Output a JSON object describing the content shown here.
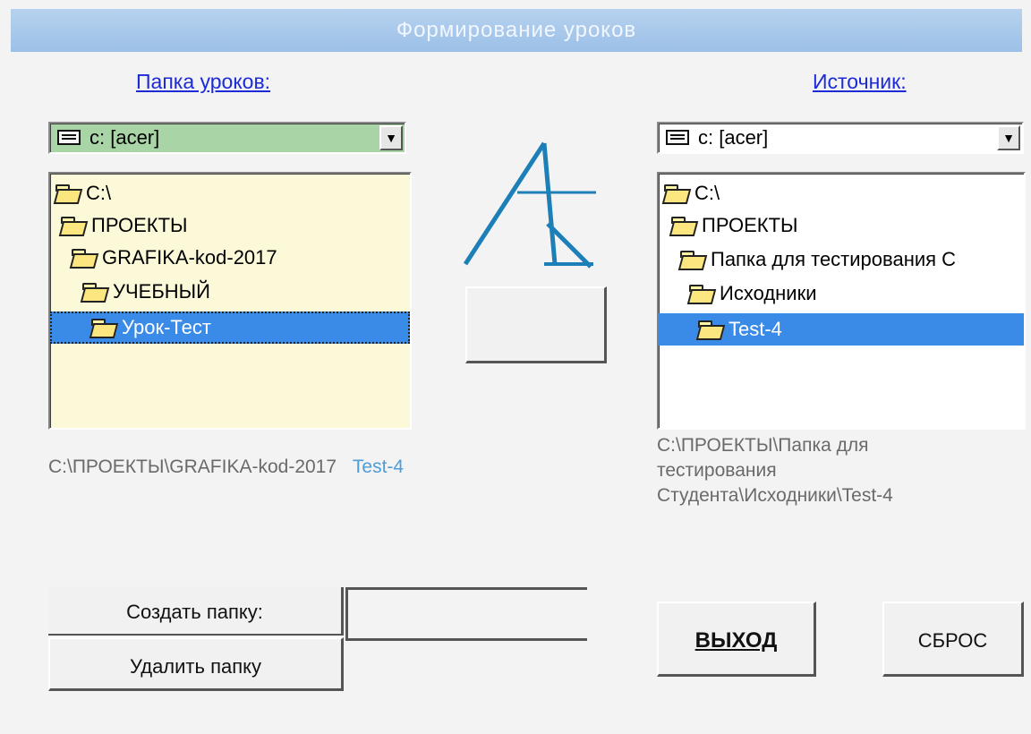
{
  "window": {
    "title": "Формирование уроков"
  },
  "left_panel": {
    "label": "Папка уроков:",
    "drive": {
      "text": "c: [acer]"
    },
    "tree": [
      {
        "label": "C:\\",
        "selected": false
      },
      {
        "label": "ПРОЕКТЫ",
        "selected": false
      },
      {
        "label": "GRAFIKA-kod-2017",
        "selected": false
      },
      {
        "label": "УЧЕБНЫЙ",
        "selected": false
      },
      {
        "label": "Урок-Тест",
        "selected": true
      }
    ],
    "path": "C:\\ПРОЕКТЫ\\GRAFIKA-kod-2017",
    "path_suffix": "Test-4"
  },
  "right_panel": {
    "label": "Источник:",
    "drive": {
      "text": "c: [acer]"
    },
    "tree": [
      {
        "label": "C:\\",
        "selected": false
      },
      {
        "label": "ПРОЕКТЫ",
        "selected": false
      },
      {
        "label": "Папка для тестирования С",
        "selected": false
      },
      {
        "label": "Исходники",
        "selected": false
      },
      {
        "label": "Test-4",
        "selected": true
      }
    ],
    "path_lines": [
      "C:\\ПРОЕКТЫ\\Папка для",
      "тестирования",
      "Студента\\Исходники\\Test-4"
    ]
  },
  "center": {
    "logo_icon": "transfer-logo-icon"
  },
  "bottom": {
    "create_folder_label": "Создать папку:",
    "delete_folder_label": "Удалить папку",
    "exit_label": "ВЫХОД",
    "reset_label": "СБРОС"
  },
  "colors": {
    "titlebar": "#a8c8ea",
    "selection": "#3a8ae8",
    "link": "#1c2bd6",
    "logo": "#1c7fb8"
  }
}
